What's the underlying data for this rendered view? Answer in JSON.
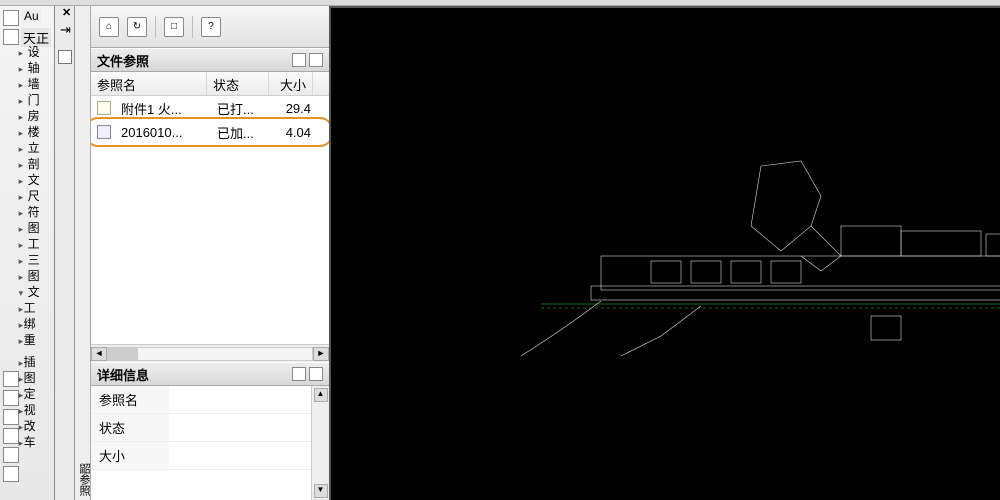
{
  "app": {
    "title_fragment_left": "Au",
    "palette_group": "天正",
    "close_glyph": "✕",
    "pin_glyph": "⇥"
  },
  "left_tools": [
    "设",
    "轴",
    "墙",
    "门",
    "房",
    "楼",
    "立",
    "剖",
    "文",
    "尺",
    "符",
    "图",
    "工",
    "三",
    "图",
    "文",
    "工",
    "绑",
    "重",
    "",
    "插",
    "图",
    "定",
    "视",
    "改",
    "车"
  ],
  "vert_label": "鼦参照",
  "palette_panel": {
    "toolbar_icons": [
      "⌂",
      "↻",
      "□",
      "?"
    ],
    "file_refs": {
      "title": "文件参照",
      "columns": [
        "参照名",
        "状态",
        "大小"
      ],
      "rows": [
        {
          "name": "附件1 火...",
          "status": "已打...",
          "size": "29.4",
          "icon": "folder"
        },
        {
          "name": "2016010...",
          "status": "已加...",
          "size": "4.04",
          "icon": "dwg",
          "highlight": true
        }
      ]
    },
    "details": {
      "title": "详细信息",
      "fields": [
        {
          "k": "参照名",
          "v": ""
        },
        {
          "k": "状态",
          "v": ""
        },
        {
          "k": "大小",
          "v": ""
        }
      ]
    }
  },
  "colors": {
    "highlight_ring": "#e69420",
    "canvas_bg": "#000000"
  }
}
